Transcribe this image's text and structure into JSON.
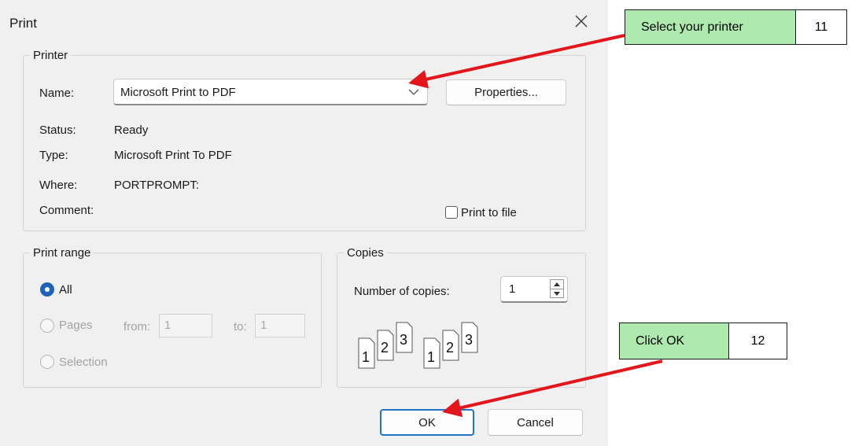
{
  "dialog": {
    "title": "Print",
    "printer": {
      "legend": "Printer",
      "name_label": "Name:",
      "name_value": "Microsoft Print to PDF",
      "properties_button": "Properties...",
      "status_label": "Status:",
      "status_value": "Ready",
      "type_label": "Type:",
      "type_value": "Microsoft Print To PDF",
      "where_label": "Where:",
      "where_value": "PORTPROMPT:",
      "comment_label": "Comment:",
      "print_to_file": "Print to file",
      "print_to_file_checked": false
    },
    "print_range": {
      "legend": "Print range",
      "all": "All",
      "pages": "Pages",
      "from_label": "from:",
      "from_value": "1",
      "to_label": "to:",
      "to_value": "1",
      "selection": "Selection",
      "selected": "All"
    },
    "copies": {
      "legend": "Copies",
      "number_label": "Number of copies:",
      "number_value": "1",
      "collate_numbers": [
        "1",
        "2",
        "3"
      ]
    },
    "ok_button": "OK",
    "cancel_button": "Cancel"
  },
  "annotations": [
    {
      "text": "Select your printer",
      "step": "11"
    },
    {
      "text": "Click OK",
      "step": "12"
    }
  ],
  "colors": {
    "callout_fill": "#aeeaae",
    "arrow": "#e3161b",
    "accent": "#1f63b8"
  }
}
